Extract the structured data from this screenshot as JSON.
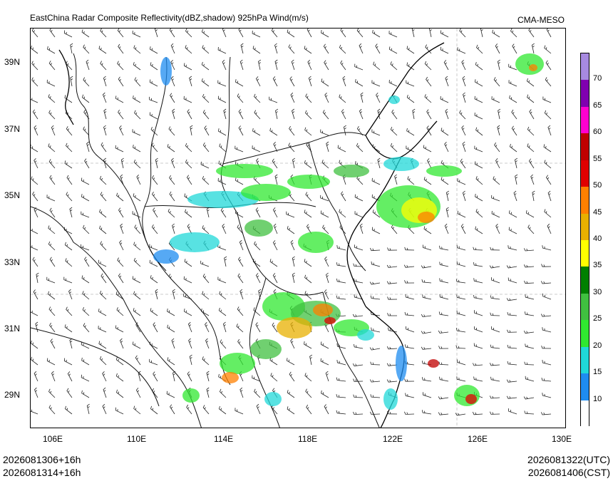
{
  "title": "EastChina Radar Composite Reflectivity(dBZ,shadow) 925hPa Wind(m/s)",
  "agency": "CMA-MESO",
  "lat_labels": [
    "39N",
    "37N",
    "35N",
    "33N",
    "31N",
    "29N"
  ],
  "lon_labels": [
    "106E",
    "110E",
    "114E",
    "118E",
    "122E",
    "126E",
    "130E"
  ],
  "colorbar": {
    "labels": [
      "70",
      "65",
      "60",
      "55",
      "50",
      "45",
      "40",
      "35",
      "30",
      "25",
      "20",
      "15",
      "10"
    ],
    "colors": [
      "#a78ae0",
      "#8000b0",
      "#ff00d0",
      "#c00000",
      "#e00000",
      "#ff8000",
      "#e8b000",
      "#ffff00",
      "#008000",
      "#40c040",
      "#30e830",
      "#20d8d8",
      "#1e8cf0",
      "#ffffff"
    ]
  },
  "footer": {
    "left_line1": "2026081306+16h",
    "left_line2": "2026081314+16h",
    "right_line1": "2026081322(UTC)",
    "right_line2": "2026081406(CST)"
  }
}
